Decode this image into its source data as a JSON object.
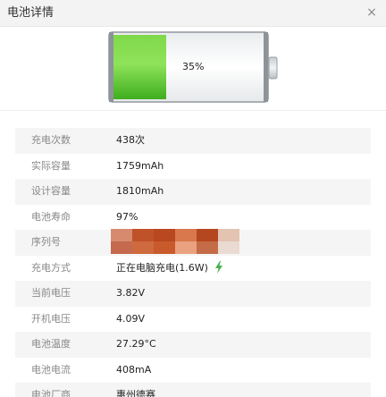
{
  "window": {
    "title": "电池详情",
    "close_glyph": "×"
  },
  "battery": {
    "percent_label": "35%",
    "level": 0.35,
    "fill_color": "#5cc22a",
    "shell_color": "#9aa0a6"
  },
  "details": [
    {
      "label": "充电次数",
      "value": "438次"
    },
    {
      "label": "实际容量",
      "value": "1759mAh"
    },
    {
      "label": "设计容量",
      "value": "1810mAh"
    },
    {
      "label": "电池寿命",
      "value": "97%"
    },
    {
      "label": "序列号",
      "value": ""
    },
    {
      "label": "充电方式",
      "value": "正在电脑充电(1.6W)"
    },
    {
      "label": "当前电压",
      "value": "3.82V"
    },
    {
      "label": "开机电压",
      "value": "4.09V"
    },
    {
      "label": "电池温度",
      "value": "27.29°C"
    },
    {
      "label": "电池电流",
      "value": "408mA"
    },
    {
      "label": "电池厂商",
      "value": "惠州德赛"
    }
  ],
  "icons": {
    "close": "close-icon",
    "charging": "lightning-bolt-icon",
    "battery": "battery-icon"
  },
  "colors": {
    "accent_green": "#4caf50",
    "redacted": "#c0522a"
  }
}
